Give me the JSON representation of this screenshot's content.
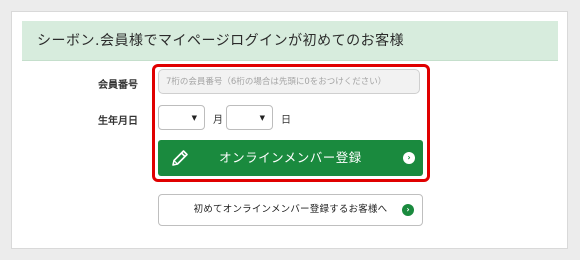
{
  "header": {
    "title": "シーボン.会員様でマイページログインが初めてのお客様"
  },
  "form": {
    "member_number_label": "会員番号",
    "member_number_placeholder": "7桁の会員番号（6桁の場合は先頭に0をおつけください）",
    "member_number_value": "",
    "birthdate_label": "生年月日",
    "month_value": "",
    "month_unit": "月",
    "day_value": "",
    "day_unit": "日"
  },
  "buttons": {
    "register_label": "オンラインメンバー登録",
    "first_time_label": "初めてオンラインメンバー登録するお客様へ"
  },
  "icons": {
    "pencil": "pencil-icon",
    "arrow": "chevron-right-circle-icon",
    "caret": "caret-down-icon"
  },
  "colors": {
    "header_bg": "#d7ecdd",
    "primary": "#1a8a3e",
    "highlight": "#e00000"
  }
}
